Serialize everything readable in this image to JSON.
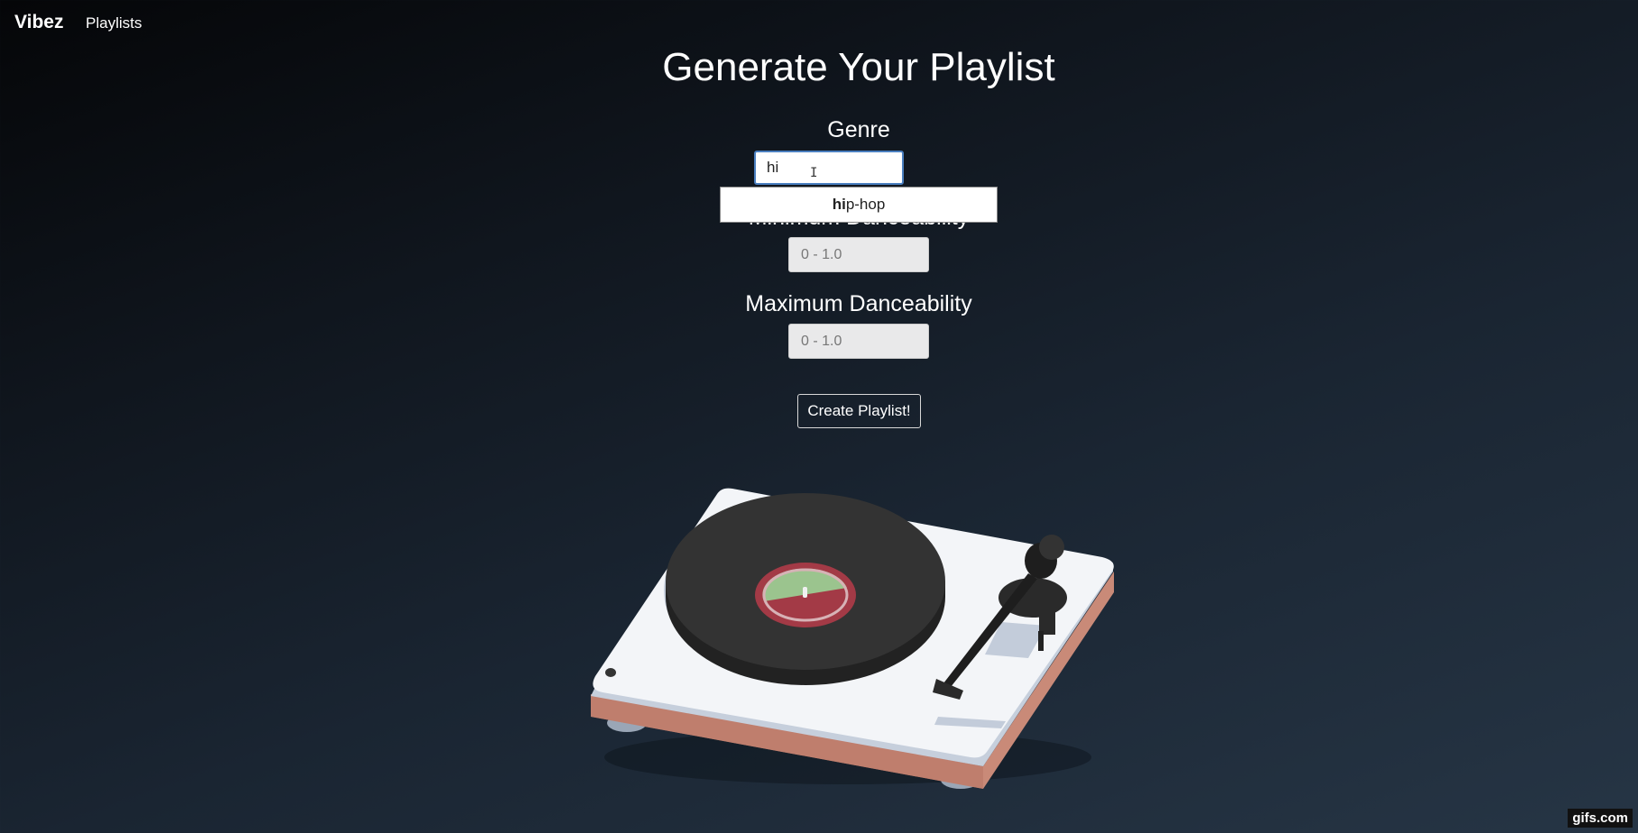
{
  "nav": {
    "brand": "Vibez",
    "links": [
      "Playlists"
    ]
  },
  "form": {
    "title": "Generate Your Playlist",
    "genre_label": "Genre",
    "genre_value": "hi",
    "suggestion": {
      "match": "hi",
      "rest": "p-hop"
    },
    "min_label": "Minimum Danceability",
    "min_placeholder": "0 - 1.0",
    "max_label": "Maximum Danceability",
    "max_placeholder": "0 - 1.0",
    "submit_label": "Create Playlist!"
  },
  "turntable": {
    "icon": "turntable-illustration",
    "label_top_color": "#9bc48e",
    "label_bottom_color": "#a33a46",
    "base_color": "#f3f5f8",
    "wood_color": "#c98a78",
    "record_color": "#333333"
  },
  "watermark": "gifs.com"
}
